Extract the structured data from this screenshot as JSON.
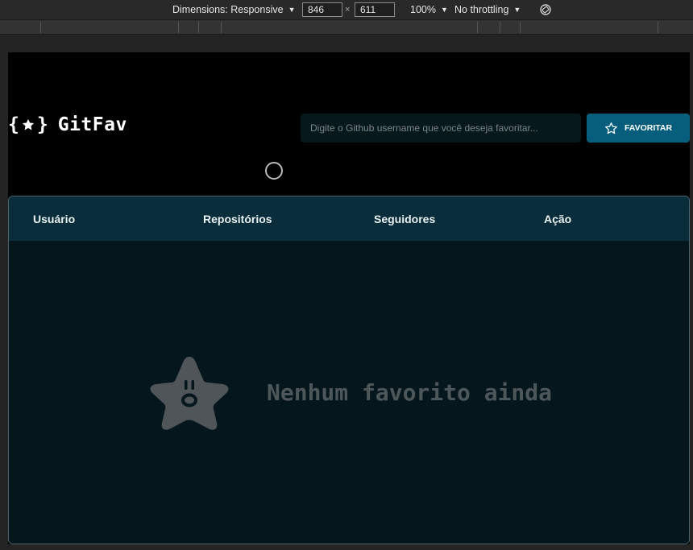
{
  "devtools": {
    "dimensions_label": "Dimensions: Responsive",
    "width_value": "846",
    "times_sign": "×",
    "height_value": "611",
    "zoom_label": "100%",
    "throttle_label": "No throttling",
    "rotate_icon": "rotate-icon"
  },
  "app": {
    "logo_left": "{",
    "logo_right": "}",
    "logo_name": "GitFav",
    "search_placeholder": "Digite o Github username que você deseja favoritar...",
    "favorite_button_label": "FAVORITAR",
    "accent_color": "#065e7c",
    "table": {
      "columns": [
        "Usuário",
        "Repositórios",
        "Seguidores",
        "Ação"
      ]
    },
    "empty_state": {
      "message": "Nenhum favorito ainda",
      "icon": "surprised-star-icon"
    }
  }
}
